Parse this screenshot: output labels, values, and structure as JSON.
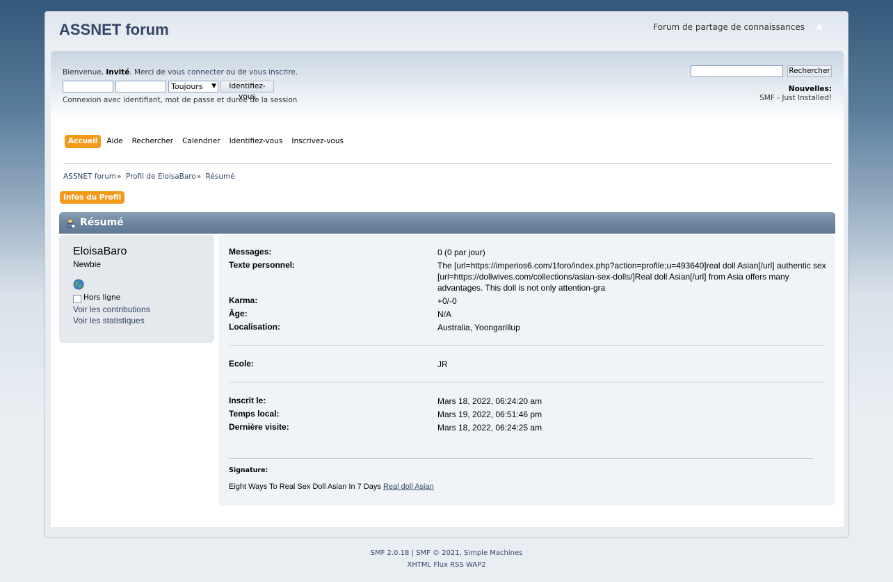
{
  "header": {
    "forum_name": "ASSNET forum",
    "slogan": "Forum de partage de connaissances"
  },
  "user_section": {
    "welcome_prefix": "Bienvenue, ",
    "guest": "Invité",
    "welcome_mid": ". Merci de ",
    "login_link": "vous connecter",
    "welcome_or": " ou de ",
    "register_link": "vous inscrire",
    "welcome_end": ".",
    "duration_value": "Toujours",
    "login_button": "Identifiez-vous",
    "login_hint": "Connexion avec identifiant, mot de passe et durée de la session"
  },
  "search": {
    "button": "Rechercher"
  },
  "news": {
    "title": "Nouvelles:",
    "body": "SMF - Just Installed!"
  },
  "menu": {
    "items": [
      {
        "label": "Accueil"
      },
      {
        "label": "Aide"
      },
      {
        "label": "Rechercher"
      },
      {
        "label": "Calendrier"
      },
      {
        "label": "Identifiez-vous"
      },
      {
        "label": "Inscrivez-vous"
      }
    ]
  },
  "breadcrumb": {
    "items": [
      "ASSNET forum",
      "Profil de EloisaBaro",
      "Résumé"
    ],
    "separator": "»"
  },
  "profile_tab": "Infos du Profil",
  "category_title": "Résumé",
  "profile": {
    "name": "EloisaBaro",
    "rank": "Newbie",
    "status": "Hors ligne",
    "link_posts": "Voir les contributions",
    "link_stats": "Voir les statistiques"
  },
  "details": {
    "messages_label": "Messages:",
    "messages_value": "0 (0 par jour)",
    "personal_text_label": "Texte personnel:",
    "personal_text_value": "The [url=https://imperios6.com/1foro/index.php?action=profile;u=493640]real doll Asian[/url] authentic sex [url=https://dollwives.com/collections/asian-sex-dolls/]Real doll Asian[/url] from Asia offers many advantages. This doll is not only attention-gra",
    "karma_label": "Karma:",
    "karma_value": "+0/-0",
    "age_label": "Âge:",
    "age_value": "N/A",
    "location_label": "Localisation:",
    "location_value": "Australia, Yoongarillup",
    "school_label": "Ecole:",
    "school_value": "JR",
    "registered_label": "Inscrit le:",
    "registered_value": "Mars 18, 2022, 06:24:20 am",
    "local_time_label": "Temps local:",
    "local_time_value": "Mars 19, 2022, 06:51:46 pm",
    "last_visit_label": "Dernière visite:",
    "last_visit_value": "Mars 18, 2022, 06:24:25 am"
  },
  "signature": {
    "label": "Signature:",
    "text": "Eight Ways To Real Sex Doll Asian In 7 Days ",
    "link": "Real doll Asian"
  },
  "footer": {
    "smf_version": "SMF 2.0.18",
    "sep": " | ",
    "copyright": "SMF © 2021",
    "comma": ", ",
    "simple_machines": "Simple Machines",
    "links": [
      "XHTML",
      "Flux RSS",
      "WAP2"
    ]
  },
  "colors": {
    "accent": "#f49a1b",
    "link": "#334466",
    "cat_bar": "#6d86a0"
  }
}
